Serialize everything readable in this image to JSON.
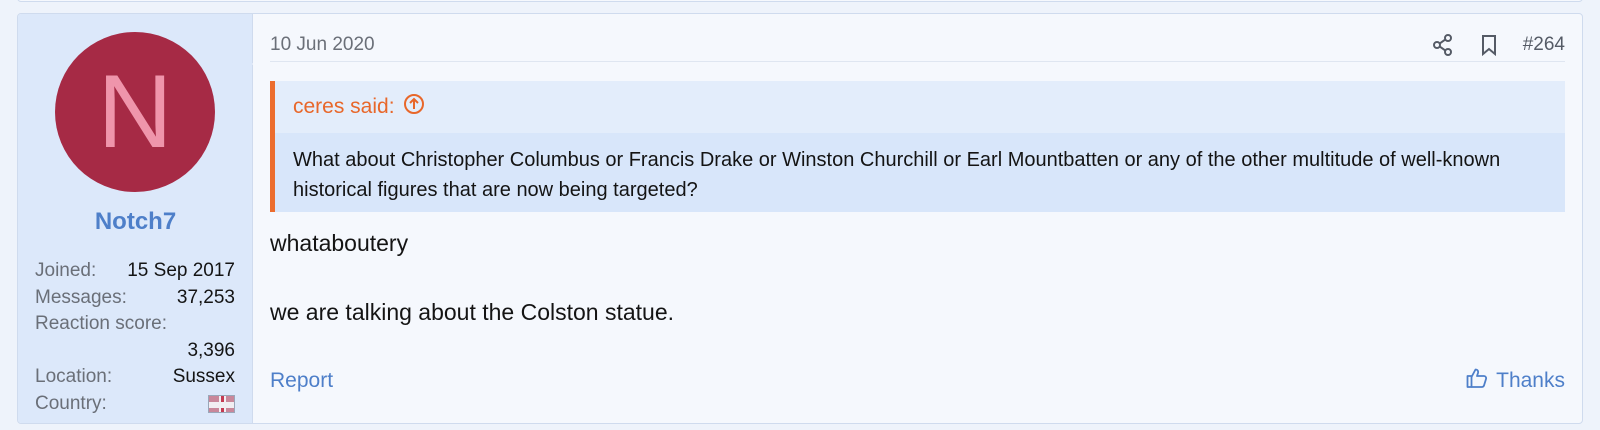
{
  "post": {
    "user": {
      "avatar_letter": "N",
      "username": "Notch7",
      "stats": [
        {
          "label": "Joined:",
          "value": "15 Sep 2017"
        },
        {
          "label": "Messages:",
          "value": "37,253"
        },
        {
          "label": "Reaction score:",
          "value": "3,396"
        },
        {
          "label": "Location:",
          "value": "Sussex"
        },
        {
          "label": "Country:",
          "value": "uk-flag-icon"
        }
      ]
    },
    "date": "10 Jun 2020",
    "number": "#264",
    "quote": {
      "author_line": "ceres said:",
      "text": "What about Christopher Columbus or Francis Drake or Winston Churchill or Earl Mountbatten or any of the other multitude of well-known historical figures that are now being targeted?"
    },
    "message": [
      "whataboutery",
      "we are talking about the Colston statue."
    ],
    "footer": {
      "report_label": "Report",
      "thanks_label": "Thanks"
    }
  },
  "colors": {
    "avatar_bg": "#a62a45",
    "link": "#4e7fc9",
    "quote_accent": "#ec6d2e"
  }
}
